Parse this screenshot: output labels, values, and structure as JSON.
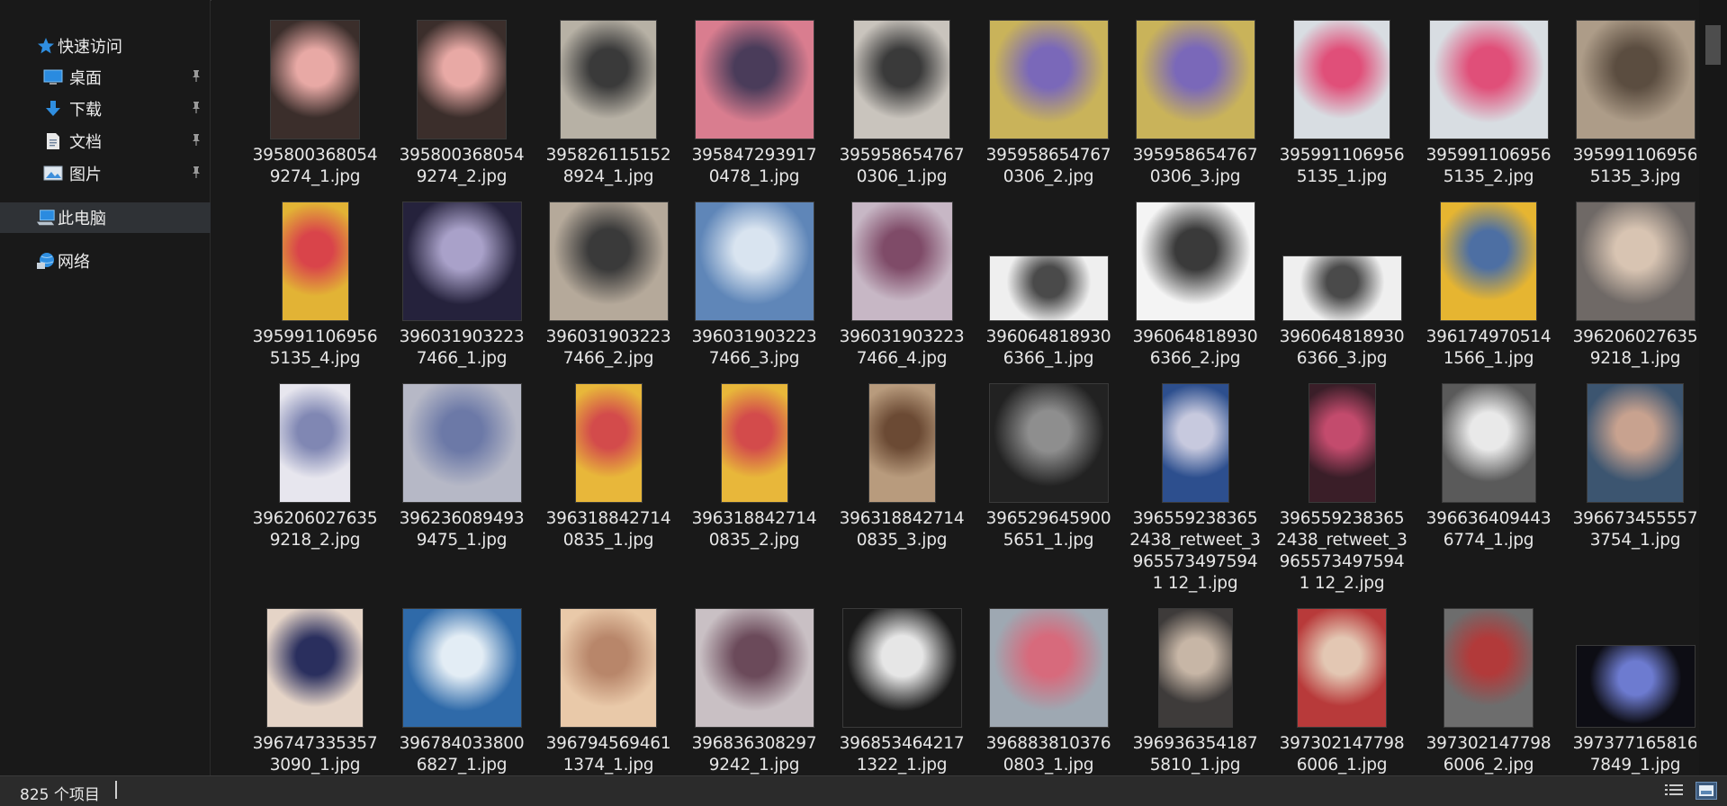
{
  "sidebar": {
    "items": [
      {
        "label": "快速访问",
        "icon": "star-icon",
        "pinned": false
      },
      {
        "label": "桌面",
        "icon": "desktop-icon",
        "pinned": true
      },
      {
        "label": "下载",
        "icon": "download-icon",
        "pinned": true
      },
      {
        "label": "文档",
        "icon": "document-icon",
        "pinned": true
      },
      {
        "label": "图片",
        "icon": "pictures-icon",
        "pinned": true
      },
      {
        "label": "此电脑",
        "icon": "computer-icon",
        "pinned": false
      },
      {
        "label": "网络",
        "icon": "network-icon",
        "pinned": false
      }
    ],
    "pin_glyph": "📌"
  },
  "files": [
    "3958003680549274_1.jpg",
    "3958003680549274_2.jpg",
    "3958261151528924_1.jpg",
    "3958472939170478_1.jpg",
    "3959586547670306_1.jpg",
    "3959586547670306_2.jpg",
    "3959586547670306_3.jpg",
    "3959911069565135_1.jpg",
    "3959911069565135_2.jpg",
    "3959911069565135_3.jpg",
    "3959911069565135_4.jpg",
    "3960319032237466_1.jpg",
    "3960319032237466_2.jpg",
    "3960319032237466_3.jpg",
    "3960319032237466_4.jpg",
    "3960648189306366_1.jpg",
    "3960648189306366_2.jpg",
    "3960648189306366_3.jpg",
    "3961749705141566_1.jpg",
    "3962060276359218_1.jpg",
    "3962060276359218_2.jpg",
    "3962360894939475_1.jpg",
    "3963188427140835_1.jpg",
    "3963188427140835_2.jpg",
    "3963188427140835_3.jpg",
    "3965296459005651_1.jpg",
    "3965592383652438_retweet_39655734975941 12_1.jpg",
    "3965592383652438_retweet_39655734975941 12_2.jpg",
    "3966364094436774_1.jpg",
    "3966734555573754_1.jpg",
    "3967473353573090_1.jpg",
    "3967840338006827_1.jpg",
    "3967945694611374_1.jpg",
    "3968363082979242_1.jpg",
    "3968534642171322_1.jpg",
    "3968838103760803_1.jpg",
    "3969363541875810_1.jpg",
    "3973021477986006_1.jpg",
    "3973021477986006_2.jpg",
    "3973771658167849_1.jpg"
  ],
  "status": {
    "item_count": "825 个项目"
  },
  "colors": {
    "background": "#191919",
    "sidebar_selected": "#2f3236",
    "statusbar": "#2b2b2b",
    "accent": "#3a8ee6"
  }
}
